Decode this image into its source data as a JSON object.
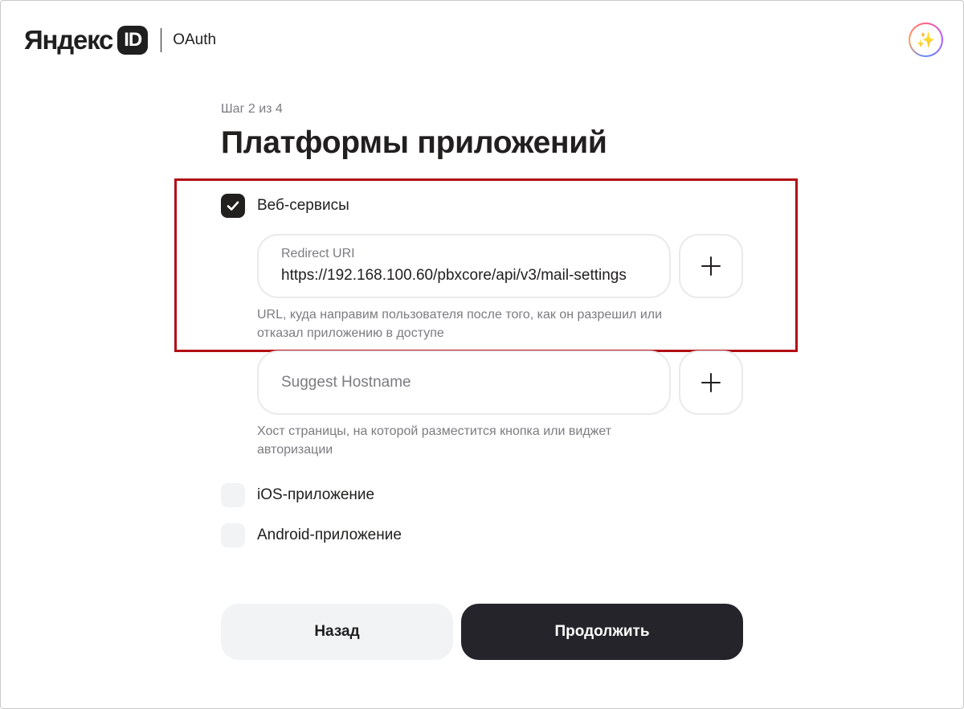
{
  "header": {
    "logo_word": "Яндекс",
    "logo_id": "ID",
    "section": "OAuth",
    "avatar_icon": "sparkles-icon"
  },
  "page": {
    "step": "Шаг 2 из 4",
    "title": "Платформы приложений"
  },
  "platforms": {
    "web": {
      "label": "Веб-сервисы",
      "checked": true,
      "redirect_uri": {
        "label": "Redirect URI",
        "value": "https://192.168.100.60/pbxcore/api/v3/mail-settings",
        "hint": "URL, куда направим пользователя после того, как он разрешил или отказал приложению в доступе"
      },
      "suggest_hostname": {
        "placeholder": "Suggest Hostname",
        "value": "",
        "hint": "Хост страницы, на которой разместится кнопка или виджет авторизации"
      }
    },
    "ios": {
      "label": "iOS-приложение",
      "checked": false
    },
    "android": {
      "label": "Android-приложение",
      "checked": false
    }
  },
  "actions": {
    "back_label": "Назад",
    "continue_label": "Продолжить"
  },
  "colors": {
    "highlight": "#b30d14",
    "primary_button": "#25242b",
    "secondary_button": "#f2f3f5"
  }
}
